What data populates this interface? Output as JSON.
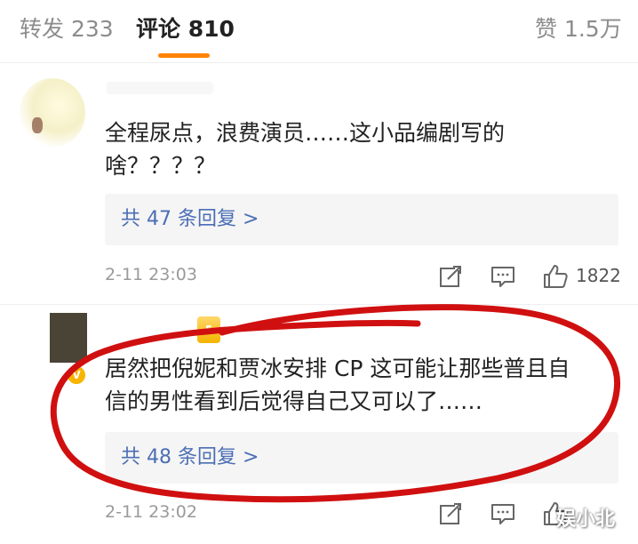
{
  "tabs": {
    "repost": "转发 233",
    "comments": "评论 810",
    "likes": "赞 1.5万"
  },
  "colors": {
    "accent": "#ff8200",
    "link": "#4b6eb4",
    "annotation": "#d01010"
  },
  "comments": [
    {
      "text_line1": "全程尿点，浪费演员……这小品编剧写的",
      "text_line2": "啥？？？？",
      "replies": "共 47 条回复 >",
      "time": "2-11 23:03",
      "likes": "1822"
    },
    {
      "text_line1": "居然把倪妮和贾冰安排 CP 这可能让那些普且自",
      "text_line2": "信的男性看到后觉得自己又可以了……",
      "replies": "共 48 条回复 >",
      "time": "2-11 23:02",
      "likes": ""
    }
  ],
  "icons": {
    "share": "share-icon",
    "comment": "comment-icon",
    "like": "thumbs-up-icon",
    "verified": "verified-badge-icon",
    "vip": "vip-badge-icon"
  },
  "watermark": "娱小北"
}
